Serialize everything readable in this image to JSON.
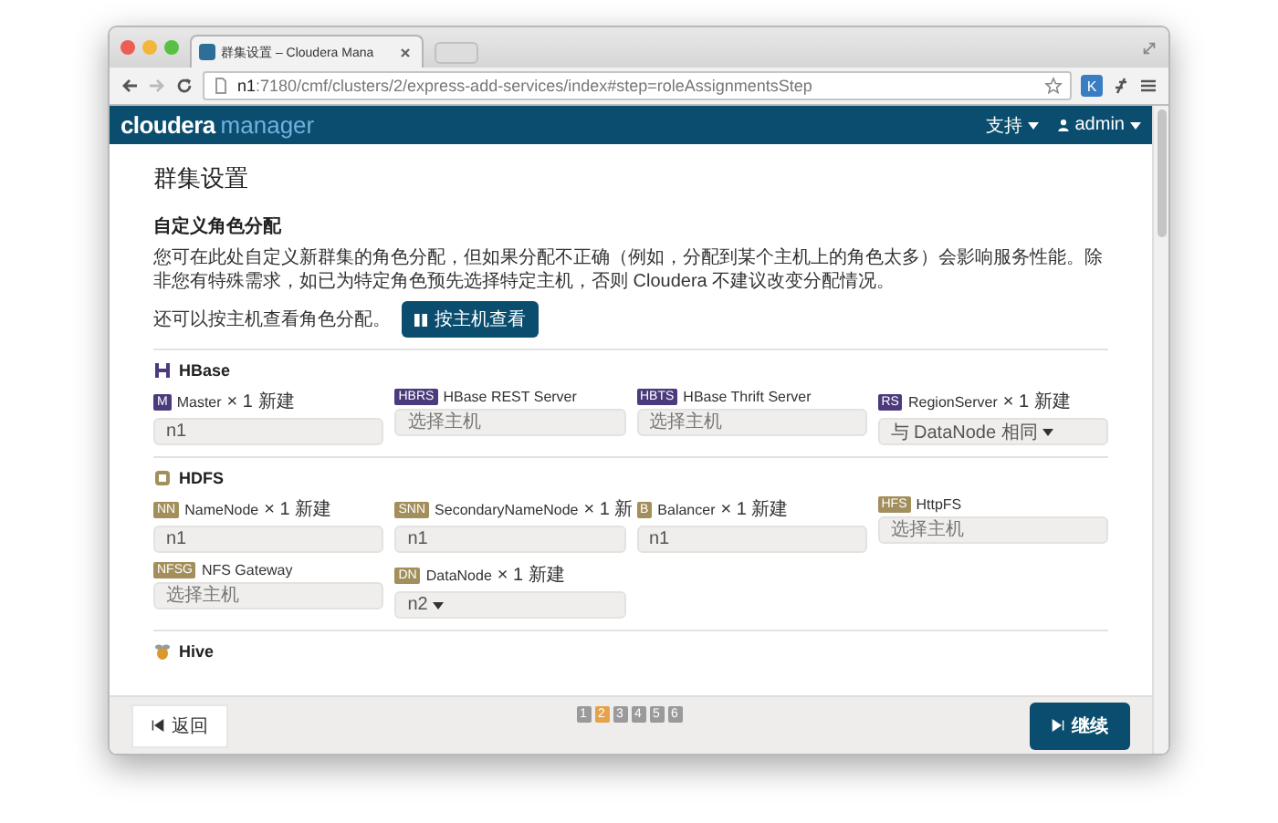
{
  "browser": {
    "tab_title": "群集设置 – Cloudera Mana",
    "url_host": "n1",
    "url_rest": ":7180/cmf/clusters/2/express-add-services/index#step=roleAssignmentsStep",
    "extension_badge": "K"
  },
  "navbar": {
    "logo_main": "cloudera",
    "logo_sub": "manager",
    "menus": [
      {
        "label": "支持",
        "kind": "plain"
      },
      {
        "label": "admin",
        "kind": "user"
      }
    ]
  },
  "page_title": "群集设置",
  "section_title": "自定义角色分配",
  "description": "您可在此处自定义新群集的角色分配，但如果分配不正确（例如，分配到某个主机上的角色太多）会影响服务性能。除非您有特殊需求，如已为特定角色预先选择特定主机，否则 Cloudera 不建议改变分配情况。",
  "host_view": {
    "text": "还可以按主机查看角色分配。",
    "button": "按主机查看"
  },
  "services": [
    {
      "name": "HBase",
      "color": "#4b3a7c",
      "roles": [
        {
          "badge": "M",
          "name": "Master",
          "count": "× 1 新建",
          "kind": "input",
          "value": "n1"
        },
        {
          "badge": "HBRS",
          "name": "HBase REST Server",
          "kind": "input",
          "placeholder": "选择主机"
        },
        {
          "badge": "HBTS",
          "name": "HBase Thrift Server",
          "kind": "input",
          "placeholder": "选择主机"
        },
        {
          "badge": "RS",
          "name": "RegionServer",
          "count": "× 1 新建",
          "kind": "dropdown",
          "value": "与 DataNode 相同"
        }
      ]
    },
    {
      "name": "HDFS",
      "color": "#a38f5c",
      "roles": [
        {
          "badge": "NN",
          "name": "NameNode",
          "count": "× 1 新建",
          "kind": "input",
          "value": "n1"
        },
        {
          "badge": "SNN",
          "name": "SecondaryNameNode",
          "count": "× 1 新",
          "kind": "input",
          "value": "n1"
        },
        {
          "badge": "B",
          "name": "Balancer",
          "count": "× 1 新建",
          "kind": "input",
          "value": "n1"
        },
        {
          "badge": "HFS",
          "name": "HttpFS",
          "kind": "input",
          "placeholder": "选择主机"
        },
        {
          "badge": "NFSG",
          "name": "NFS Gateway",
          "kind": "input",
          "placeholder": "选择主机"
        },
        {
          "badge": "DN",
          "name": "DataNode",
          "count": "× 1 新建",
          "kind": "dropdown",
          "value": "n2"
        }
      ]
    },
    {
      "name": "Hive",
      "color": "#d99a2b"
    }
  ],
  "footer": {
    "back": "返回",
    "continue": "继续",
    "steps": [
      {
        "label": "1",
        "selected": false
      },
      {
        "label": "2",
        "selected": true
      },
      {
        "label": "3",
        "selected": false
      },
      {
        "label": "4",
        "selected": false
      },
      {
        "label": "5",
        "selected": false
      },
      {
        "label": "6",
        "selected": false
      }
    ]
  }
}
